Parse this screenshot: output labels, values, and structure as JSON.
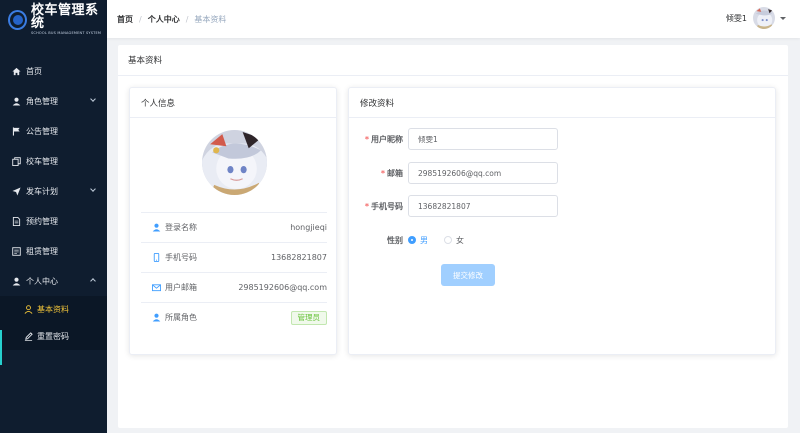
{
  "brand": {
    "title": "校车管理系统",
    "subtitle": "SCHOOL BUS MANAGEMENT SYSTEM"
  },
  "sidebar": {
    "items": [
      {
        "label": "首页",
        "icon": "home-icon"
      },
      {
        "label": "角色管理",
        "icon": "user-icon",
        "expandable": true
      },
      {
        "label": "公告管理",
        "icon": "flag-icon"
      },
      {
        "label": "校车管理",
        "icon": "copy-icon"
      },
      {
        "label": "发车计划",
        "icon": "send-icon",
        "expandable": true
      },
      {
        "label": "预约管理",
        "icon": "document-icon"
      },
      {
        "label": "租赁管理",
        "icon": "tickets-icon"
      },
      {
        "label": "个人中心",
        "icon": "user-icon",
        "expanded": true
      }
    ],
    "sub_items": [
      {
        "label": "基本资料",
        "icon": "user-outline-icon",
        "active": true
      },
      {
        "label": "重置密码",
        "icon": "edit-icon"
      }
    ]
  },
  "breadcrumb": [
    "首页",
    "个人中心",
    "基本资料"
  ],
  "header": {
    "username": "倾雯1"
  },
  "page": {
    "title": "基本资料"
  },
  "profile": {
    "title": "个人信息",
    "rows": [
      {
        "key": "登录名称",
        "value": "hongjieqi",
        "icon": "user-icon"
      },
      {
        "key": "手机号码",
        "value": "13682821807",
        "icon": "mobile-icon"
      },
      {
        "key": "用户邮箱",
        "value": "2985192606@qq.com",
        "icon": "mail-icon"
      },
      {
        "key": "所属角色",
        "value": "管理员",
        "icon": "user-icon"
      }
    ]
  },
  "edit": {
    "title": "修改资料",
    "fields": {
      "nickname": {
        "label": "用户昵称",
        "value": "倾雯1"
      },
      "email": {
        "label": "邮箱",
        "value": "2985192606@qq.com"
      },
      "phone": {
        "label": "手机号码",
        "value": "13682821807"
      }
    },
    "gender": {
      "label": "性别",
      "options": [
        "男",
        "女"
      ],
      "selected": "男"
    },
    "submit_label": "提交修改"
  },
  "colors": {
    "sidebar_bg": "#0f1d2f",
    "active": "#f0c43a",
    "primary": "#409eff",
    "required": "#f56c6c",
    "tag_green": "#67c23a"
  }
}
